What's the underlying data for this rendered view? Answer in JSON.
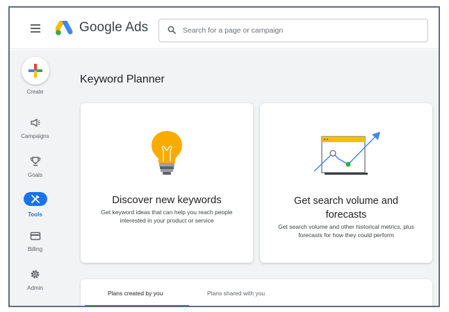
{
  "app": {
    "brand": "Google Ads"
  },
  "search": {
    "placeholder": "Search for a page or campaign"
  },
  "sidebar": {
    "create_label": "Create",
    "items": [
      {
        "label": "Campaigns",
        "icon": "megaphone-icon"
      },
      {
        "label": "Goals",
        "icon": "trophy-icon"
      },
      {
        "label": "Tools",
        "icon": "tools-icon",
        "active": true
      },
      {
        "label": "Billing",
        "icon": "credit-card-icon"
      },
      {
        "label": "Admin",
        "icon": "gear-icon"
      }
    ]
  },
  "main": {
    "title": "Keyword Planner",
    "cards": [
      {
        "title": "Discover new keywords",
        "description": "Get keyword ideas that can help you reach people interested in your product or service",
        "icon": "lightbulb-icon"
      },
      {
        "title": "Get search volume and forecasts",
        "description": "Get search volume and other historical metrics, plus forecasts for how they could perform",
        "icon": "forecast-chart-icon"
      }
    ],
    "tabs": [
      {
        "label": "Plans created by you",
        "active": true
      },
      {
        "label": "Plans shared with you",
        "active": false
      }
    ]
  },
  "colors": {
    "accent": "#1a73e8",
    "nav_background": "#f1f3f4",
    "lightbulb": "#f9ab00"
  }
}
